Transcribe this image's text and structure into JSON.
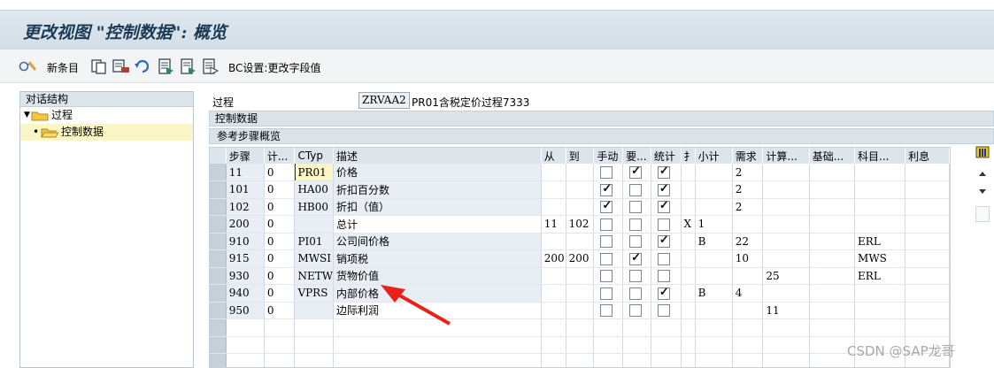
{
  "window": {
    "title": "更改视图 \"控制数据\": 概览"
  },
  "toolbar": {
    "new_entries_label": "新条目",
    "bc_label": "BC设置:更改字段值"
  },
  "left_panel": {
    "header": "对话结构",
    "items": [
      {
        "label": "过程",
        "expanded": true,
        "selected": false
      },
      {
        "label": "控制数据",
        "selected": true
      }
    ]
  },
  "procedure": {
    "label": "过程",
    "value": "ZRVAA2",
    "description": "PR01含税定价过程7333"
  },
  "section": {
    "control_data": "控制数据",
    "reference_steps": "参考步骤概览"
  },
  "table": {
    "headers": [
      "步骤",
      "计...",
      "CTyp",
      "描述",
      "从",
      "到",
      "手动",
      "要...",
      "统计",
      "扌",
      "小计",
      "需求",
      "计算...",
      "基础...",
      "科目...",
      "利息"
    ],
    "rows": [
      {
        "step": "11",
        "counter": "0",
        "ctyp": "PR01",
        "desc": "价格",
        "from": "",
        "to": "",
        "manual": false,
        "required": true,
        "statistical": true,
        "print": "",
        "subtotal": "",
        "requirement": "2",
        "calc": "",
        "base": "",
        "account": "",
        "accrual": ""
      },
      {
        "step": "101",
        "counter": "0",
        "ctyp": "HA00",
        "desc": "折扣百分数",
        "from": "",
        "to": "",
        "manual": true,
        "required": false,
        "statistical": true,
        "print": "",
        "subtotal": "",
        "requirement": "2",
        "calc": "",
        "base": "",
        "account": "",
        "accrual": ""
      },
      {
        "step": "102",
        "counter": "0",
        "ctyp": "HB00",
        "desc": "折扣（值）",
        "from": "",
        "to": "",
        "manual": true,
        "required": false,
        "statistical": true,
        "print": "",
        "subtotal": "",
        "requirement": "2",
        "calc": "",
        "base": "",
        "account": "",
        "accrual": ""
      },
      {
        "step": "200",
        "counter": "0",
        "ctyp": "",
        "desc": "总计",
        "from": "11",
        "to": "102",
        "manual": false,
        "required": false,
        "statistical": false,
        "print": "X",
        "subtotal": "1",
        "requirement": "",
        "calc": "",
        "base": "",
        "account": "",
        "accrual": ""
      },
      {
        "step": "910",
        "counter": "0",
        "ctyp": "PI01",
        "desc": "公司间价格",
        "from": "",
        "to": "",
        "manual": false,
        "required": false,
        "statistical": true,
        "print": "",
        "subtotal": "B",
        "requirement": "22",
        "calc": "",
        "base": "",
        "account": "ERL",
        "accrual": ""
      },
      {
        "step": "915",
        "counter": "0",
        "ctyp": "MWSI",
        "desc": "销项税",
        "from": "200",
        "to": "200",
        "manual": false,
        "required": true,
        "statistical": false,
        "print": "",
        "subtotal": "",
        "requirement": "10",
        "calc": "",
        "base": "",
        "account": "MWS",
        "accrual": ""
      },
      {
        "step": "930",
        "counter": "0",
        "ctyp": "NETW",
        "desc": "货物价值",
        "from": "",
        "to": "",
        "manual": false,
        "required": false,
        "statistical": false,
        "print": "",
        "subtotal": "",
        "requirement": "",
        "calc": "25",
        "base": "",
        "account": "ERL",
        "accrual": ""
      },
      {
        "step": "940",
        "counter": "0",
        "ctyp": "VPRS",
        "desc": "内部价格",
        "from": "",
        "to": "",
        "manual": false,
        "required": false,
        "statistical": true,
        "print": "",
        "subtotal": "B",
        "requirement": "4",
        "calc": "",
        "base": "",
        "account": "",
        "accrual": ""
      },
      {
        "step": "950",
        "counter": "0",
        "ctyp": "",
        "desc": "边际利润",
        "from": "",
        "to": "",
        "manual": false,
        "required": false,
        "statistical": false,
        "print": "",
        "subtotal": "",
        "requirement": "",
        "calc": "11",
        "base": "",
        "account": "",
        "accrual": ""
      }
    ],
    "empty_rows": 3
  },
  "watermark": "CSDN @SAP龙哥",
  "colors": {
    "title": "#1c3a55",
    "selected_tree": "#fbf6c5",
    "header_bg": "#dde5ec",
    "annotation_arrow": "#e8211b"
  }
}
